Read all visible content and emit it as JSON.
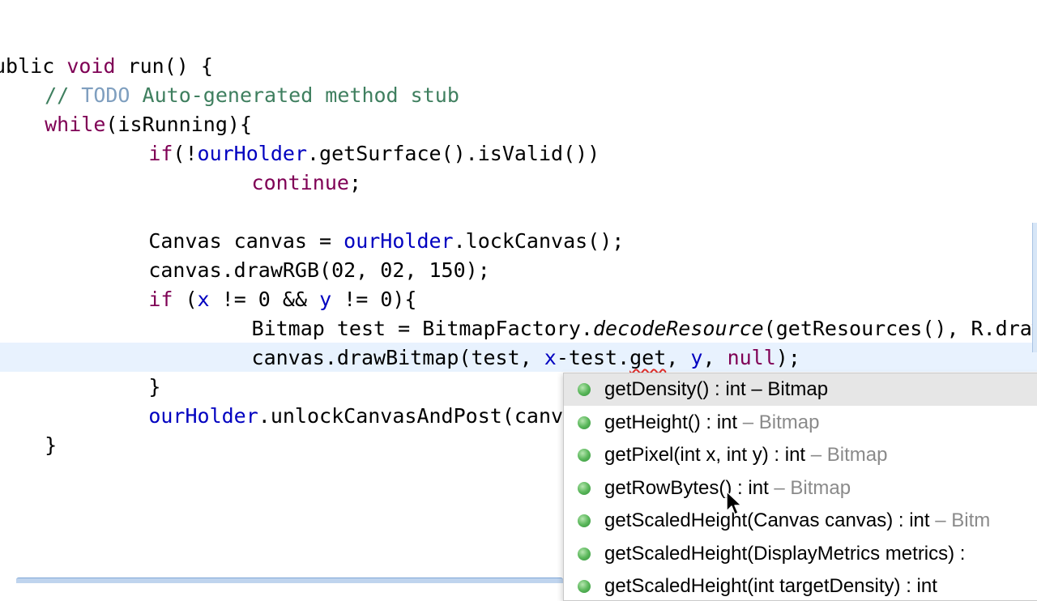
{
  "editor": {
    "lines": [
      {
        "indent": "",
        "tokens": [
          [
            "plain",
            "ublic "
          ],
          [
            "kw",
            "void"
          ],
          [
            "plain",
            " run() {"
          ]
        ]
      },
      {
        "indent": "  ",
        "tokens": [
          [
            "cm",
            "// "
          ],
          [
            "todo",
            "TODO"
          ],
          [
            "cm",
            " Auto-generated method stub"
          ]
        ]
      },
      {
        "indent": "  ",
        "tokens": [
          [
            "kw",
            "while"
          ],
          [
            "plain",
            "(isRunning){"
          ]
        ]
      },
      {
        "indent": "      ",
        "tokens": [
          [
            "kw",
            "if"
          ],
          [
            "plain",
            "(!"
          ],
          [
            "fld",
            "ourHolder"
          ],
          [
            "plain",
            ".getSurface().isValid())"
          ]
        ]
      },
      {
        "indent": "          ",
        "tokens": [
          [
            "kw",
            "continue"
          ],
          [
            "plain",
            ";"
          ]
        ]
      },
      {
        "indent": "",
        "tokens": []
      },
      {
        "indent": "      ",
        "tokens": [
          [
            "plain",
            "Canvas canvas = "
          ],
          [
            "fld",
            "ourHolder"
          ],
          [
            "plain",
            ".lockCanvas();"
          ]
        ]
      },
      {
        "indent": "      ",
        "tokens": [
          [
            "plain",
            "canvas.drawRGB(02, 02, 150);"
          ]
        ]
      },
      {
        "indent": "      ",
        "tokens": [
          [
            "kw",
            "if"
          ],
          [
            "plain",
            " ("
          ],
          [
            "fld",
            "x"
          ],
          [
            "plain",
            " != 0 && "
          ],
          [
            "fld",
            "y"
          ],
          [
            "plain",
            " != 0){"
          ]
        ]
      },
      {
        "indent": "          ",
        "tokens": [
          [
            "plain",
            "Bitmap test = BitmapFactory."
          ],
          [
            "it",
            "decodeResource"
          ],
          [
            "plain",
            "(getResources(), R.drawa"
          ]
        ]
      },
      {
        "indent": "          ",
        "tokens": [
          [
            "plain",
            "canvas.drawBitmap(test, "
          ],
          [
            "fld",
            "x"
          ],
          [
            "plain",
            "-test."
          ],
          [
            "squig",
            "get"
          ],
          [
            "plain",
            ", "
          ],
          [
            "fld",
            "y"
          ],
          [
            "plain",
            ", "
          ],
          [
            "kw",
            "null"
          ],
          [
            "plain",
            ");"
          ]
        ]
      },
      {
        "indent": "      ",
        "tokens": [
          [
            "plain",
            "}"
          ]
        ]
      },
      {
        "indent": "      ",
        "tokens": [
          [
            "fld",
            "ourHolder"
          ],
          [
            "plain",
            ".unlockCanvasAndPost(canvas"
          ]
        ]
      },
      {
        "indent": "  ",
        "tokens": [
          [
            "plain",
            "}"
          ]
        ]
      }
    ]
  },
  "autocomplete": {
    "items": [
      {
        "signature": "getDensity() : int",
        "owner": " – Bitmap"
      },
      {
        "signature": "getHeight() : int",
        "owner": " – Bitmap"
      },
      {
        "signature": "getPixel(int x, int y) : int",
        "owner": " – Bitmap"
      },
      {
        "signature": "getRowBytes() : int",
        "owner": " – Bitmap"
      },
      {
        "signature": "getScaledHeight(Canvas canvas) : int",
        "owner": " – Bitm"
      },
      {
        "signature": "getScaledHeight(DisplayMetrics metrics) : ",
        "owner": ""
      },
      {
        "signature": "getScaledHeight(int targetDensity) : int",
        "owner": ""
      }
    ],
    "selected_index": 0
  },
  "colors": {
    "keyword": "#7f0055",
    "comment": "#3f7f5f",
    "field": "#0000c0",
    "current_line": "#e8f2fe",
    "method_dot": "#5cb85c"
  },
  "icons": {
    "method": "public-method-icon",
    "pointer": "mouse-pointer-icon"
  }
}
